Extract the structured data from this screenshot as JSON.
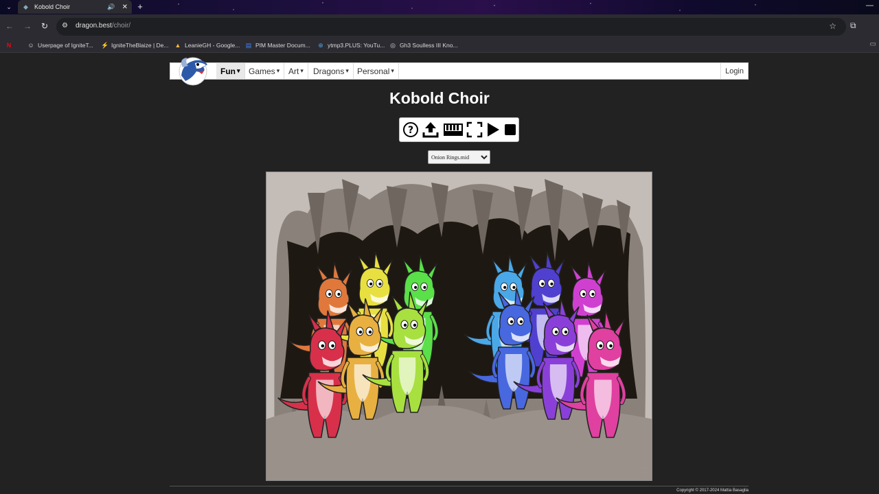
{
  "browser": {
    "tab_title": "Kobold Choir",
    "url_host": "dragon.best",
    "url_path": "/choir/",
    "bookmarks": [
      {
        "label": "Userpage of IgniteT...",
        "icon": "user-icon"
      },
      {
        "label": "IgniteTheBlaize | De...",
        "icon": "deviantart-icon"
      },
      {
        "label": "LeanieGH - Google...",
        "icon": "google-drive-icon"
      },
      {
        "label": "PIM Master Docum...",
        "icon": "doc-icon"
      },
      {
        "label": "ytmp3.PLUS: YouTu...",
        "icon": "download-icon"
      },
      {
        "label": "Gh3 Soulless III Kno...",
        "icon": "globe-icon"
      }
    ]
  },
  "site": {
    "nav": [
      {
        "label": "Fun",
        "active": true
      },
      {
        "label": "Games",
        "active": false
      },
      {
        "label": "Art",
        "active": false
      },
      {
        "label": "Dragons",
        "active": false
      },
      {
        "label": "Personal",
        "active": false
      }
    ],
    "login_label": "Login"
  },
  "page": {
    "title": "Kobold Choir",
    "controls": [
      "help-icon",
      "upload-icon",
      "keyboard-icon",
      "fullscreen-icon",
      "play-icon",
      "stop-icon"
    ],
    "song_select": {
      "selected": "Onion Rings.mid",
      "options": [
        "Onion Rings.mid"
      ]
    },
    "kobold_colors": [
      "#d8304a",
      "#e0783c",
      "#e8b040",
      "#e8e040",
      "#a8e040",
      "#5ae048",
      "#4aa8e8",
      "#4868e0",
      "#5040d0",
      "#8a40d8",
      "#d040d0",
      "#e040a0"
    ],
    "copyright": "Copyright © 2017-2024 Mattia Basaglia"
  }
}
